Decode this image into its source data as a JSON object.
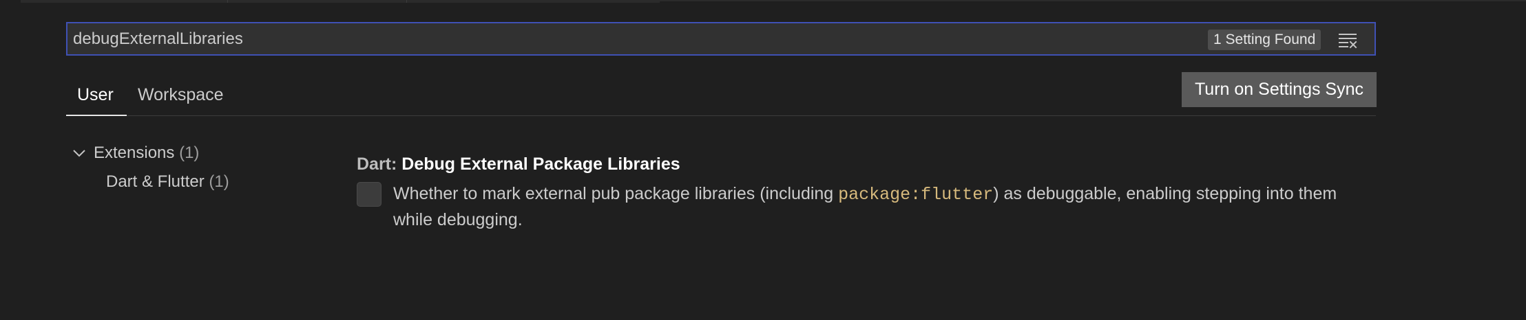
{
  "search": {
    "value": "debugExternalLibraries",
    "results_badge": "1 Setting Found",
    "clear_icon": "clear-filter-icon"
  },
  "tabs": [
    {
      "label": "User",
      "active": true
    },
    {
      "label": "Workspace",
      "active": false
    }
  ],
  "sync_button": {
    "label": "Turn on Settings Sync"
  },
  "toc": {
    "groups": [
      {
        "label": "Extensions",
        "count": "(1)",
        "expanded": true,
        "icon": "chevron-down-icon",
        "children": [
          {
            "label": "Dart & Flutter",
            "count": "(1)"
          }
        ]
      }
    ]
  },
  "setting": {
    "category": "Dart: ",
    "name": "Debug External Package Libraries",
    "checked": false,
    "description_before": "Whether to mark external pub package libraries (including ",
    "description_code": "package:flutter",
    "description_after": ") as debuggable, enabling stepping into them while debugging."
  },
  "colors": {
    "background": "#1f1f1f",
    "search_border": "#3f51b5",
    "code_color": "#d7ba7d",
    "button_bg": "#5a5a5a"
  }
}
